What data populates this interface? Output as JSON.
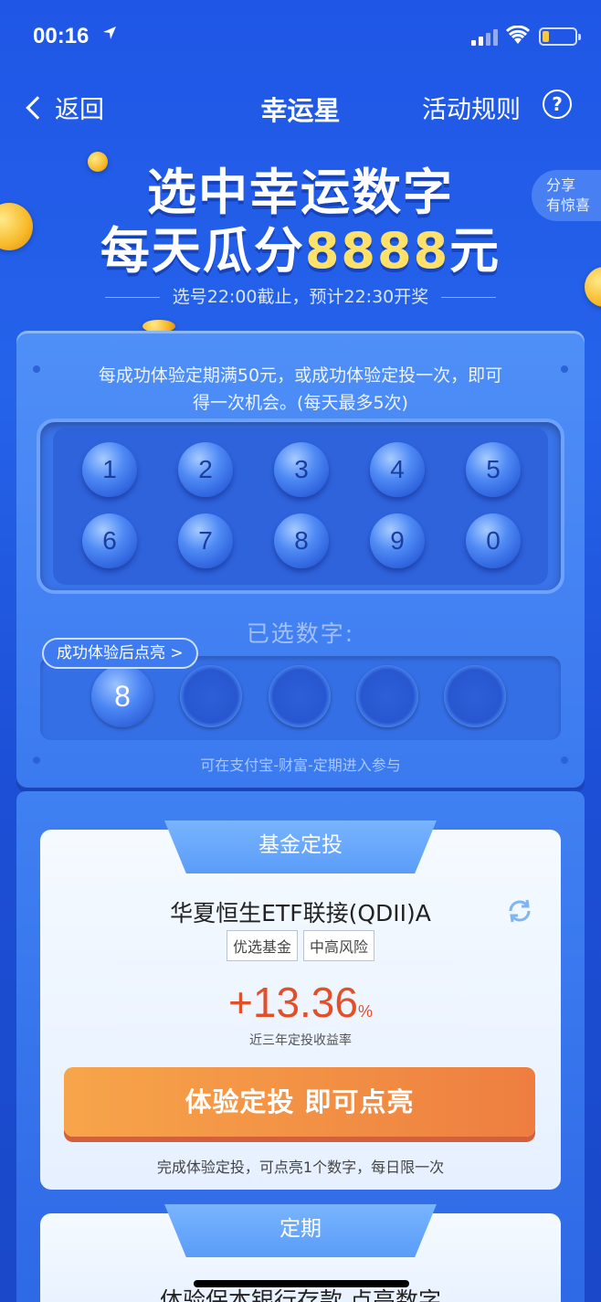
{
  "status": {
    "time": "00:16"
  },
  "nav": {
    "back_label": "返回",
    "title": "幸运星",
    "rules_label": "活动规则",
    "help_glyph": "?"
  },
  "hero": {
    "line1": "选中幸运数字",
    "line2_prefix": "每天瓜分",
    "line2_amount": "8888",
    "line2_suffix": "元",
    "share_line1": "分享",
    "share_line2": "有惊喜",
    "deadline": "选号22:00截止，预计22:30开奖"
  },
  "panel": {
    "desc_line1": "每成功体验定期满50元，或成功体验定投一次，即可",
    "desc_line2": "得一次机会。(每天最多5次)",
    "balls": [
      "1",
      "2",
      "3",
      "4",
      "5",
      "6",
      "7",
      "8",
      "9",
      "0"
    ],
    "selected_label": "已选数字:",
    "tip": "成功体验后点亮 >",
    "selected_number": "8",
    "footer": "可在支付宝-财富-定期进入参与"
  },
  "fund_card": {
    "tab": "基金定投",
    "name": "华夏恒生ETF联接(QDII)A",
    "tag1": "优选基金",
    "tag2": "中高风险",
    "yield": "+13.36",
    "yield_unit": "%",
    "yield_label": "近三年定投收益率",
    "cta": "体验定投 即可点亮",
    "cta_note": "完成体验定投，可点亮1个数字，每日限一次"
  },
  "term_card": {
    "tab": "定期",
    "title": "体验保本银行存款 点亮数字"
  },
  "colors": {
    "accent_yellow": "#ffe169",
    "cta_orange": "#ee7e40",
    "yield_red": "#e2502a",
    "brand_blue": "#2563ea"
  }
}
